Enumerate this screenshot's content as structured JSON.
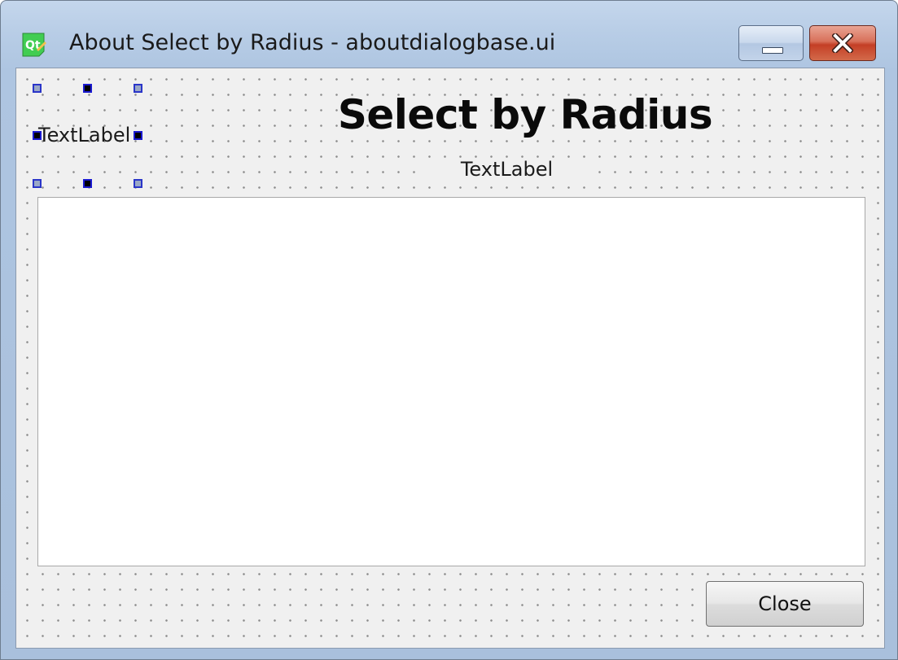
{
  "window": {
    "title": "About Select by Radius - aboutdialogbase.ui",
    "app_icon": "qt-logo-icon",
    "controls": {
      "minimize_icon": "minimize-icon",
      "close_icon": "close-icon"
    }
  },
  "dialog": {
    "heading": "Select by Radius",
    "version_label": "TextLabel",
    "selected_label": "TextLabel",
    "text_browser_content": "",
    "close_button_label": "Close"
  },
  "colors": {
    "title_bar": "#b8cde6",
    "client_bg": "#f0f0f0",
    "close_control": "#c43f26",
    "selection_handle": "#1a1ad0"
  }
}
